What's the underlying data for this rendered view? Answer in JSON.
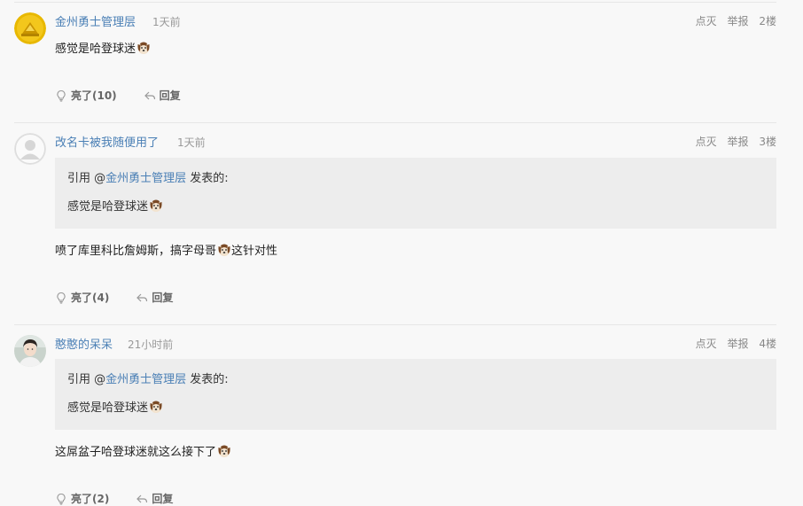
{
  "comments": [
    {
      "username": "金州勇士管理层",
      "time": "1天前",
      "dislike": "点灭",
      "report": "举报",
      "floor": "2楼",
      "body": "感觉是哈登球迷",
      "like_label": "亮了(10)",
      "reply_label": "回复",
      "avatar": "gold-team-logo"
    },
    {
      "username": "改名卡被我随便用了",
      "time": "1天前",
      "dislike": "点灭",
      "report": "举报",
      "floor": "3楼",
      "quote": {
        "prefix": "引用 @",
        "user": "金州勇士管理层",
        "suffix": " 发表的:",
        "body": "感觉是哈登球迷"
      },
      "body_before_emoji": "喷了库里科比詹姆斯，搞字母哥",
      "body_after_emoji": "这针对性",
      "like_label": "亮了(4)",
      "reply_label": "回复",
      "avatar": "default-avatar"
    },
    {
      "username": "憨憨的呆呆",
      "time": "21小时前",
      "dislike": "点灭",
      "report": "举报",
      "floor": "4楼",
      "quote": {
        "prefix": "引用 @",
        "user": "金州勇士管理层",
        "suffix": " 发表的:",
        "body": "感觉是哈登球迷"
      },
      "body": "这屌盆子哈登球迷就这么接下了",
      "like_label": "亮了(2)",
      "reply_label": "回复",
      "avatar": "photo-avatar"
    }
  ],
  "colors": {
    "link": "#4a7fb5",
    "quote_bg": "#ededed",
    "page_bg": "#f8f8f8"
  }
}
